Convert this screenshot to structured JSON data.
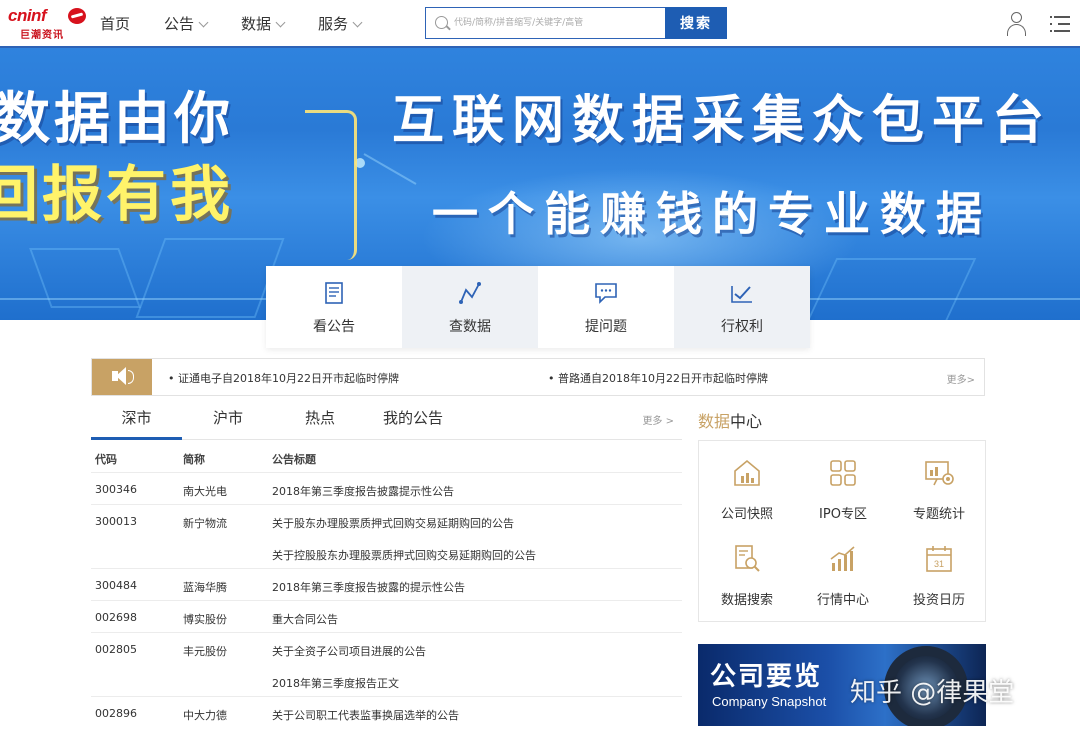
{
  "header": {
    "logo_text": "cninf",
    "logo_sub": "巨潮资讯",
    "nav": [
      {
        "label": "首页",
        "has_dropdown": false
      },
      {
        "label": "公告",
        "has_dropdown": true
      },
      {
        "label": "数据",
        "has_dropdown": true
      },
      {
        "label": "服务",
        "has_dropdown": true
      }
    ],
    "search_placeholder": "代码/简称/拼音缩写/关键字/高管",
    "search_button": "搜索",
    "icons": [
      "user-icon",
      "menu-icon"
    ]
  },
  "banner": {
    "left_line1": "数据由你",
    "left_line2": "回报有我",
    "right_line1": "互联网数据采集众包平台",
    "right_line2": "一个能赚钱的专业数据"
  },
  "quick_tiles": [
    {
      "label": "看公告",
      "icon": "document-icon"
    },
    {
      "label": "查数据",
      "icon": "chart-line-icon"
    },
    {
      "label": "提问题",
      "icon": "chat-icon"
    },
    {
      "label": "行权利",
      "icon": "check-chart-icon"
    }
  ],
  "notice": {
    "items": [
      "证通电子自2018年10月22日开市起临时停牌",
      "普路通自2018年10月22日开市起临时停牌"
    ],
    "more": "更多>"
  },
  "tabs": {
    "items": [
      "深市",
      "沪市",
      "热点",
      "我的公告"
    ],
    "active": "深市",
    "more": "更多 >"
  },
  "table": {
    "headers": [
      "代码",
      "简称",
      "公告标题"
    ],
    "rows": [
      {
        "code": "300346",
        "name": "南大光电",
        "title": "2018年第三季度报告披露提示性公告"
      },
      {
        "code": "300013",
        "name": "新宁物流",
        "title": "关于股东办理股票质押式回购交易延期购回的公告"
      },
      {
        "code": "",
        "name": "",
        "title": "关于控股股东办理股票质押式回购交易延期购回的公告"
      },
      {
        "code": "300484",
        "name": "蓝海华腾",
        "title": "2018年第三季度报告披露的提示性公告"
      },
      {
        "code": "002698",
        "name": "博实股份",
        "title": "重大合同公告"
      },
      {
        "code": "002805",
        "name": "丰元股份",
        "title": "关于全资子公司项目进展的公告"
      },
      {
        "code": "",
        "name": "",
        "title": "2018年第三季度报告正文"
      },
      {
        "code": "002896",
        "name": "中大力德",
        "title": "关于公司职工代表监事换届选举的公告"
      }
    ]
  },
  "data_center": {
    "title_highlight": "数据",
    "title_rest": "中心",
    "items": [
      {
        "label": "公司快照",
        "icon": "house-chart-icon"
      },
      {
        "label": "IPO专区",
        "icon": "grid-icon"
      },
      {
        "label": "专题统计",
        "icon": "presentation-icon"
      },
      {
        "label": "数据搜索",
        "icon": "document-search-icon"
      },
      {
        "label": "行情中心",
        "icon": "bar-trend-icon"
      },
      {
        "label": "投资日历",
        "icon": "calendar-icon"
      }
    ],
    "calendar_day": "31"
  },
  "ad": {
    "title": "公司要览",
    "subtitle": "Company Snapshot"
  },
  "watermark": "知乎 @律果堂",
  "colors": {
    "brand_blue": "#1e5db3",
    "brand_red": "#d7121d",
    "gold": "#c8a265"
  }
}
